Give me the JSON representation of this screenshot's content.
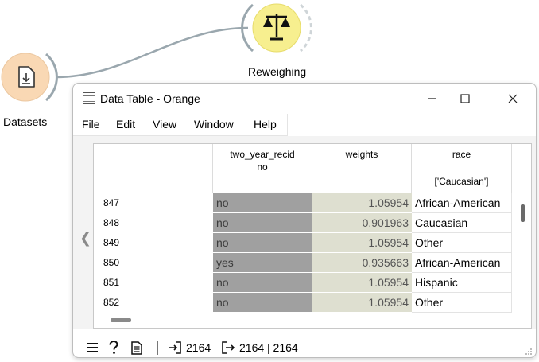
{
  "canvas": {
    "widgets": [
      {
        "label": "Datasets",
        "icon": "datasets-download-icon"
      },
      {
        "label": "Reweighing",
        "icon": "balance-scale-icon"
      }
    ]
  },
  "window": {
    "title": "Data Table - Orange",
    "menu": [
      "File",
      "Edit",
      "View",
      "Window",
      "Help"
    ],
    "table": {
      "columns": [
        {
          "name": "two_year_recid",
          "subtitle": "no",
          "extra": ""
        },
        {
          "name": "weights",
          "subtitle": "",
          "extra": ""
        },
        {
          "name": "race",
          "subtitle": "",
          "extra": "['Caucasian']"
        }
      ],
      "rows": [
        {
          "index": "847",
          "two_year_recid": "no",
          "weights": "1.05954",
          "race": "African-American"
        },
        {
          "index": "848",
          "two_year_recid": "no",
          "weights": "0.901963",
          "race": "Caucasian"
        },
        {
          "index": "849",
          "two_year_recid": "no",
          "weights": "1.05954",
          "race": "Other"
        },
        {
          "index": "850",
          "two_year_recid": "yes",
          "weights": "0.935663",
          "race": "African-American"
        },
        {
          "index": "851",
          "two_year_recid": "no",
          "weights": "1.05954",
          "race": "Hispanic"
        },
        {
          "index": "852",
          "two_year_recid": "no",
          "weights": "1.05954",
          "race": "Other"
        }
      ]
    },
    "status": {
      "input_count": "2164",
      "output_count": "2164 | 2164"
    }
  },
  "colors": {
    "widget_fill_datasets": "#f9d8b4",
    "widget_fill_reweighing": "#f7ef8f",
    "recid_cell": "#a0a0a0",
    "weight_cell": "#dedfd0",
    "link_line": "#9aa7ae"
  }
}
